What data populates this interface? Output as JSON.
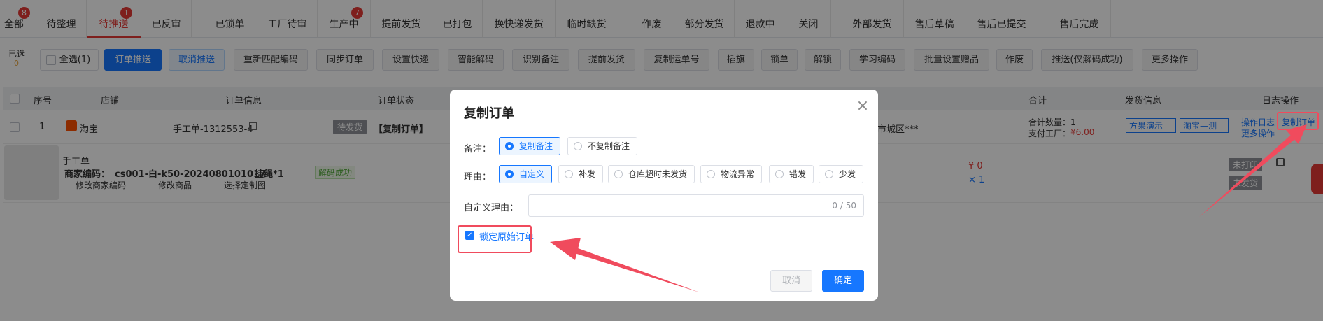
{
  "tabs": [
    {
      "label": "全部",
      "badge": "8"
    },
    {
      "label": "待整理",
      "badge": ""
    },
    {
      "label": "待推送",
      "badge": "1"
    },
    {
      "label": "已反审",
      "badge": ""
    },
    {
      "label": "已锁单",
      "badge": ""
    },
    {
      "label": "工厂待审",
      "badge": ""
    },
    {
      "label": "生产中",
      "badge": "7"
    },
    {
      "label": "提前发货",
      "badge": ""
    },
    {
      "label": "已打包",
      "badge": ""
    },
    {
      "label": "换快递发货",
      "badge": ""
    },
    {
      "label": "临时缺货",
      "badge": ""
    },
    {
      "label": "作废",
      "badge": ""
    },
    {
      "label": "部分发货",
      "badge": ""
    },
    {
      "label": "退款中",
      "badge": ""
    },
    {
      "label": "关闭",
      "badge": ""
    },
    {
      "label": "外部发货",
      "badge": ""
    },
    {
      "label": "售后草稿",
      "badge": ""
    },
    {
      "label": "售后已提交",
      "badge": ""
    },
    {
      "label": "售后完成",
      "badge": ""
    }
  ],
  "toolbar": {
    "selected_label": "已选",
    "selected_count": "0",
    "select_all": "全选(1)",
    "buttons": [
      "订单推送",
      "取消推送",
      "重新匹配编码",
      "同步订单",
      "设置快递",
      "智能解码",
      "识别备注",
      "提前发货",
      "复制运单号",
      "插旗",
      "锁单",
      "解锁",
      "学习编码",
      "批量设置赠品",
      "作废",
      "推送(仅解码成功)",
      "更多操作"
    ]
  },
  "table": {
    "headers": [
      "序号",
      "店铺",
      "订单信息",
      "订单状态",
      "合计",
      "发货信息",
      "日志操作"
    ],
    "row": {
      "index": "1",
      "shop": "淘宝",
      "order_no": "手工单-1312553-4",
      "status": "待发货",
      "status_tag": "【复制订单】",
      "address": "市城区***",
      "total_qty": "合计数量：1",
      "factory_pay_label": "支付工厂：",
      "factory_pay": "¥6.00",
      "ship_select_1": "方果演示",
      "ship_select_2": "淘宝—测",
      "op_log": "操作日志",
      "copy_order": "复制订单",
      "more_ops": "更多操作"
    },
    "item": {
      "title": "手工单",
      "merchant_code_label": "商家编码：",
      "merchant_code": "cs001-白-k50-2024080101017",
      "spec": "挂绳*1",
      "decode_status": "解码成功",
      "edit_code": "修改商家编码",
      "edit_product": "修改商品",
      "choose_image": "选择定制图",
      "price": "¥ 0",
      "qty": "× 1",
      "print_status": "未打印",
      "ship_status": "未发货"
    }
  },
  "modal": {
    "title": "复制订单",
    "remark_label": "备注：",
    "remark_options": [
      "复制备注",
      "不复制备注"
    ],
    "reason_label": "理由：",
    "reason_options": [
      "自定义",
      "补发",
      "仓库超时未发货",
      "物流异常",
      "错发",
      "少发"
    ],
    "custom_reason_label": "自定义理由：",
    "custom_reason_value": "",
    "char_count": "0 / 50",
    "lock_label": "锁定原始订单",
    "cancel": "取消",
    "confirm": "确定"
  },
  "colors": {
    "accent": "#1677ff",
    "danger": "#e53935",
    "annotation": "#f04b5d"
  }
}
